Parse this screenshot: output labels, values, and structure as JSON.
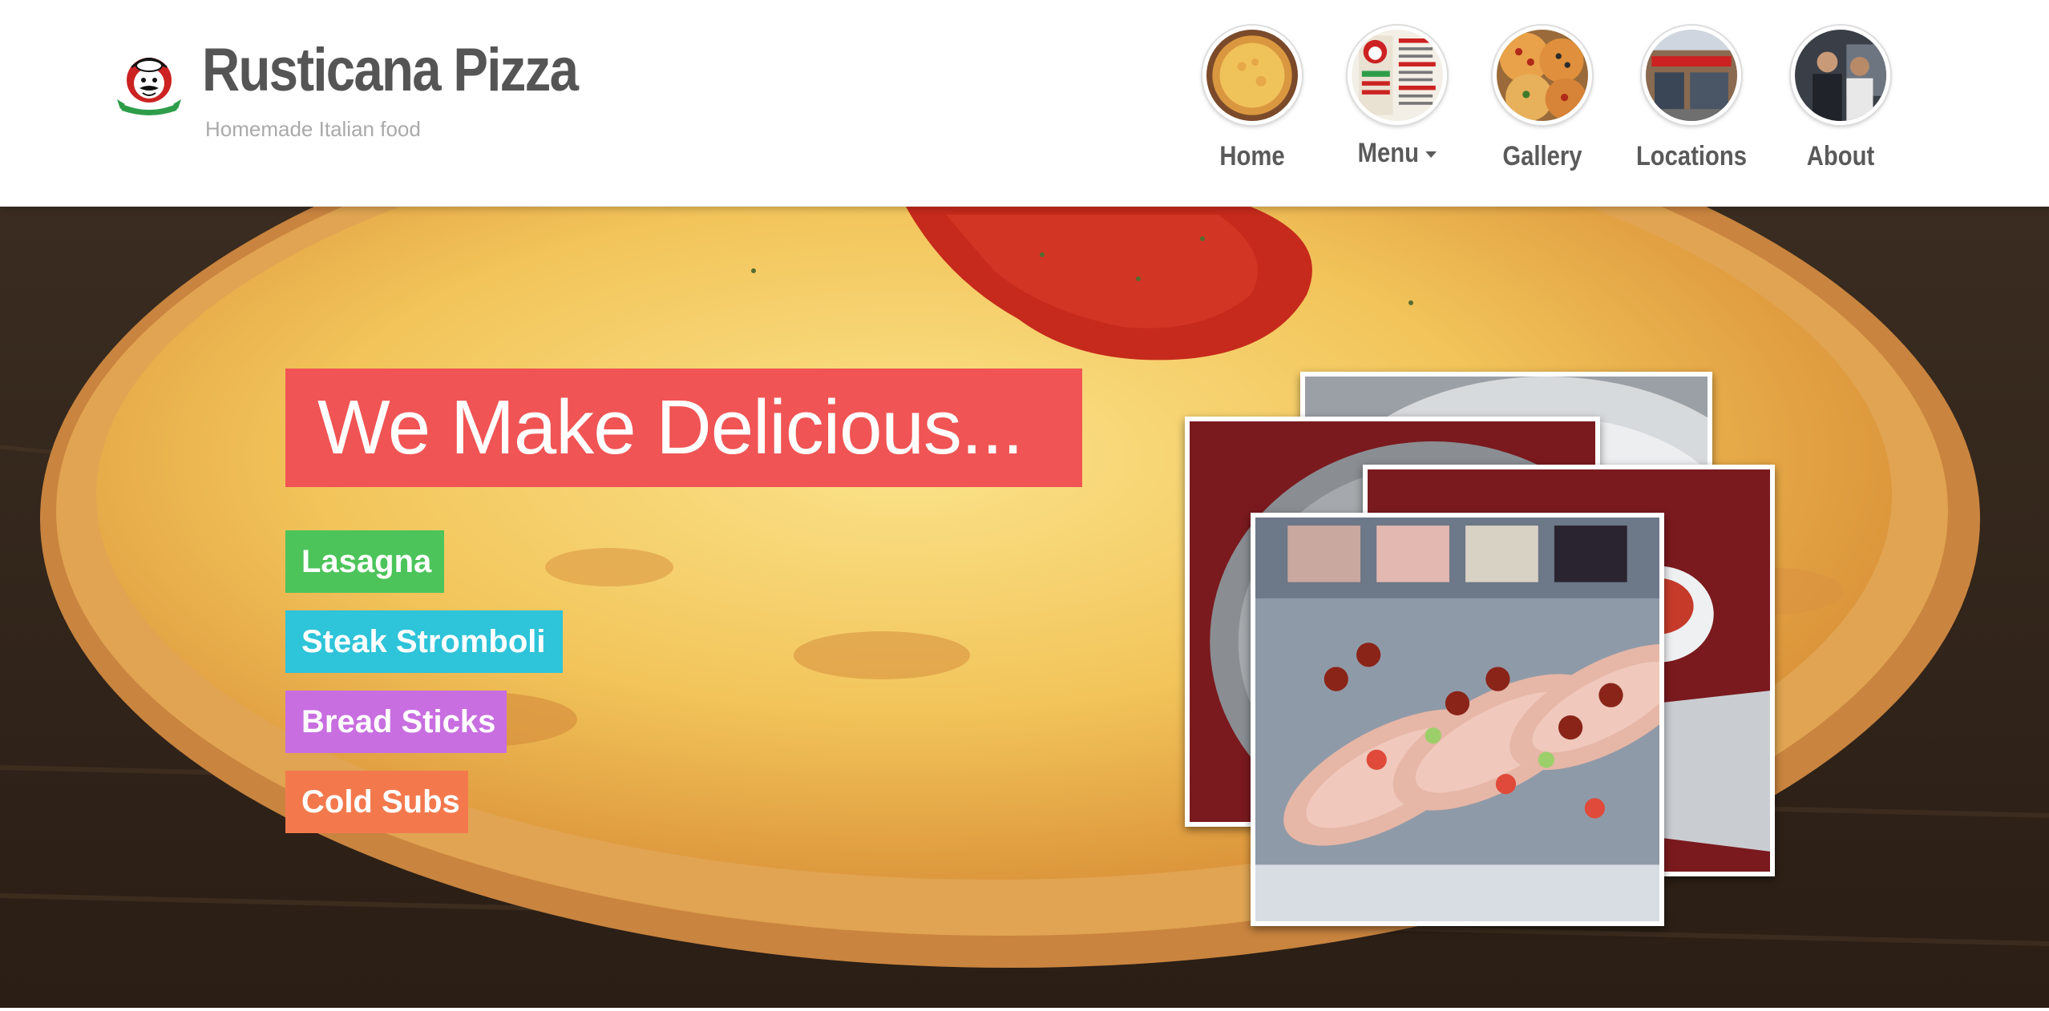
{
  "header": {
    "title": "Rusticana Pizza",
    "tagline": "Homemade Italian food",
    "logo_icon": "chef-mascot-logo"
  },
  "nav": {
    "items": [
      {
        "label": "Home",
        "thumb_icon": "cheese-pizza-thumbnail"
      },
      {
        "label": "Menu",
        "thumb_icon": "menu-flyer-thumbnail",
        "has_dropdown": true
      },
      {
        "label": "Gallery",
        "thumb_icon": "pizzas-thumbnail"
      },
      {
        "label": "Locations",
        "thumb_icon": "storefront-thumbnail"
      },
      {
        "label": "About",
        "thumb_icon": "staff-thumbnail"
      }
    ]
  },
  "hero": {
    "headline": "We Make Delicious...",
    "items": [
      {
        "label": "Lasagna",
        "color": "#4cc45a"
      },
      {
        "label": "Steak Stromboli",
        "color": "#2ec4d9"
      },
      {
        "label": "Bread Sticks",
        "color": "#c86ee0"
      },
      {
        "label": "Cold Subs",
        "color": "#f3794d"
      }
    ],
    "headline_color": "#f05454",
    "photos": [
      "food-photo",
      "food-photo",
      "food-photo",
      "cold-subs-photo"
    ]
  },
  "colors": {
    "title": "#555555",
    "tagline": "#aaaaaa",
    "nav_label": "#5a5a5a"
  }
}
